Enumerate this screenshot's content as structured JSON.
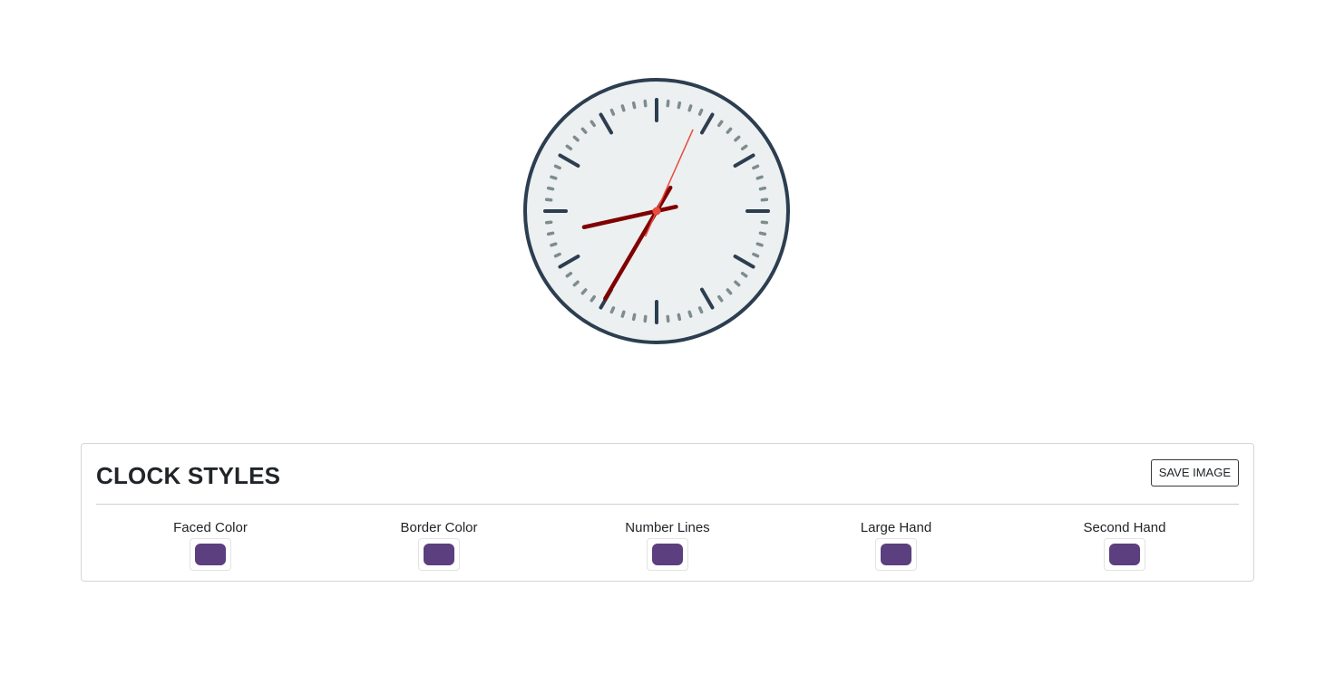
{
  "clock": {
    "time": {
      "hours": 8,
      "minutes": 35,
      "seconds": 4
    },
    "colors": {
      "face": "#ecf0f1",
      "border": "#2c3e50",
      "hour_marks": "#2c3e50",
      "minute_marks": "#7f8c8d",
      "large_hands": "#800000",
      "second_hand": "#e74c3c",
      "center_dot": "#e74c3c"
    }
  },
  "panel": {
    "title": "CLOCK STYLES",
    "save_label": "SAVE IMAGE",
    "controls": [
      {
        "label": "Faced Color",
        "value": "#5b3f7e"
      },
      {
        "label": "Border Color",
        "value": "#5b3f7e"
      },
      {
        "label": "Number Lines",
        "value": "#5b3f7e"
      },
      {
        "label": "Large Hand",
        "value": "#5b3f7e"
      },
      {
        "label": "Second Hand",
        "value": "#5b3f7e"
      }
    ]
  }
}
